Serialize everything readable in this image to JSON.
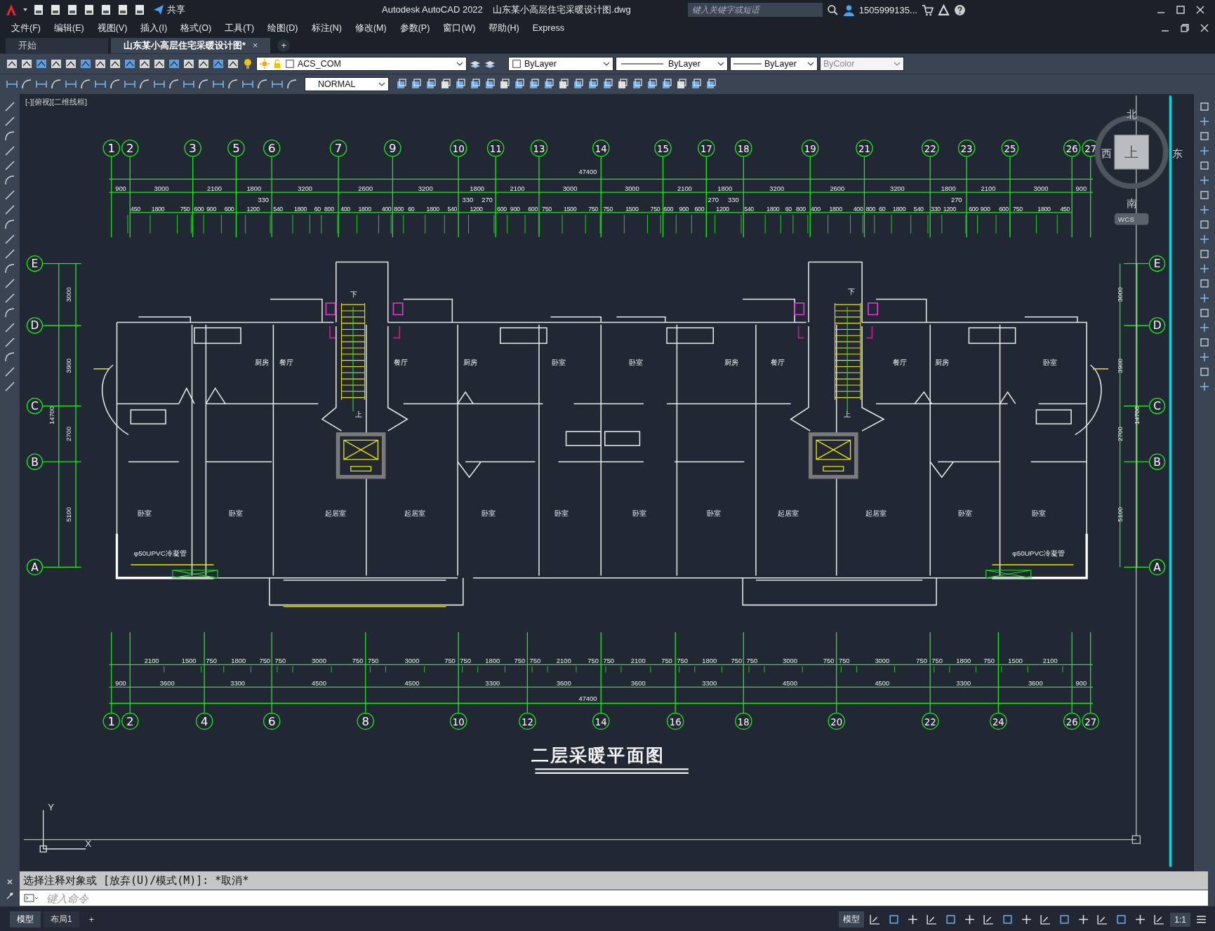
{
  "title_bar": {
    "share": "共享",
    "title": "Autodesk AutoCAD 2022    山东某小高层住宅采暖设计图.dwg",
    "search": {
      "placeholder": "键入关键字或短语"
    },
    "user": "1505999135..."
  },
  "menu": [
    "文件(F)",
    "编辑(E)",
    "视图(V)",
    "插入(I)",
    "格式(O)",
    "工具(T)",
    "绘图(D)",
    "标注(N)",
    "修改(M)",
    "参数(P)",
    "窗口(W)",
    "帮助(H)",
    "Express"
  ],
  "file_tabs": [
    {
      "label": "开始",
      "selected": false
    },
    {
      "label": "山东某小高层住宅采暖设计图*",
      "selected": true,
      "close": "×"
    }
  ],
  "new_tab": "+",
  "toolbar": {
    "layer": "ACS_COM",
    "paint_setting": "ByLayer",
    "linetype": "ByLayer",
    "lineweight": "ByLayer",
    "plot_style": {
      "label": "ByColor",
      "disabled": true
    },
    "text_style": "NORMAL"
  },
  "viewport_label": "[-][俯视][二维线框]",
  "view_cube": {
    "north": "北",
    "south": "南",
    "east": "东",
    "west": "西",
    "top": "上",
    "ucs": "WCS"
  },
  "drawing": {
    "top_axes": [
      "1",
      "2",
      "3",
      "5",
      "6",
      "7",
      "9",
      "10",
      "11",
      "13",
      "14",
      "15",
      "17",
      "18",
      "19",
      "21",
      "22",
      "23",
      "25",
      "26",
      "27"
    ],
    "top_total": "47400",
    "top_dims": [
      "900",
      "3000",
      "2100",
      "1800",
      "3200",
      "2600",
      "3200",
      "1800",
      "2100",
      "3000",
      "3000",
      "2100",
      "1800",
      "3200",
      "2600",
      "3200",
      "1800",
      "2100",
      "3000",
      "900"
    ],
    "top_raised": [
      "330",
      "330",
      "270",
      "270",
      "330",
      "270"
    ],
    "top_subdims": [
      "450",
      "1800",
      "750",
      "600",
      "900",
      "600",
      "1200",
      "540",
      "1800",
      "60",
      "800",
      "400",
      "1800",
      "400",
      "800",
      "60",
      "1800",
      "540",
      "1200",
      "600",
      "900",
      "600",
      "750",
      "1500",
      "750",
      "750",
      "1500",
      "750",
      "600",
      "900",
      "600",
      "1200",
      "540",
      "1800",
      "60",
      "800",
      "400",
      "1800",
      "400",
      "800",
      "60",
      "1800",
      "540",
      "330",
      "1200",
      "600",
      "900",
      "600",
      "750",
      "1800",
      "450"
    ],
    "left_axes": [
      "E",
      "D",
      "C",
      "B",
      "A"
    ],
    "left_dims": [
      "3000",
      "3900",
      "2700",
      "5100"
    ],
    "left_total": "14700",
    "right_axes": [
      "E",
      "D",
      "C",
      "B",
      "A"
    ],
    "right_dims": [
      "3000",
      "3900",
      "2700",
      "5100"
    ],
    "right_total": "14700",
    "rooms": [
      "厨房",
      "餐厅",
      "餐厅",
      "厨房",
      "卧室",
      "卧室",
      "厨房",
      "餐厅",
      "餐厅",
      "厨房",
      "卧室",
      "卧室",
      "卧室",
      "起居室",
      "起居室",
      "卧室",
      "卧室",
      "卧室",
      "卧室",
      "起居室",
      "起居室",
      "卧室",
      "卧室"
    ],
    "stair_marks": [
      "下",
      "上",
      "下",
      "上"
    ],
    "notes": [
      "φ50UPVC冷凝管",
      "φ50UPVC冷凝管"
    ],
    "bottom_subdims": [
      "2100",
      "1500",
      "750",
      "1800",
      "750",
      "750",
      "3000",
      "750",
      "750",
      "3000",
      "750",
      "750",
      "1800",
      "750",
      "750",
      "2100",
      "750",
      "750",
      "2100",
      "750",
      "750",
      "1800",
      "750",
      "750",
      "3000",
      "750",
      "750",
      "3000",
      "750",
      "750",
      "1800",
      "750",
      "1500",
      "2100"
    ],
    "bottom_dims": [
      "900",
      "3600",
      "3300",
      "4500",
      "4500",
      "3300",
      "3600",
      "3600",
      "3300",
      "4500",
      "4500",
      "3300",
      "3600",
      "900"
    ],
    "bottom_total": "47400",
    "bottom_axes": [
      "1",
      "2",
      "4",
      "6",
      "8",
      "10",
      "12",
      "14",
      "16",
      "18",
      "20",
      "22",
      "24",
      "26",
      "27"
    ],
    "title": "二层采暖平面图",
    "ucs": {
      "x": "X",
      "y": "Y"
    }
  },
  "command_line": {
    "history": "选择注释对象或 [放弃(U)/模式(M)]: *取消*",
    "placeholder": "键入命令"
  },
  "layout_tabs": [
    {
      "label": "模型",
      "selected": true
    },
    {
      "label": "布局1",
      "selected": false
    }
  ],
  "new_layout": "+",
  "status_bar": {
    "mode": "模型",
    "scale": "1:1"
  }
}
